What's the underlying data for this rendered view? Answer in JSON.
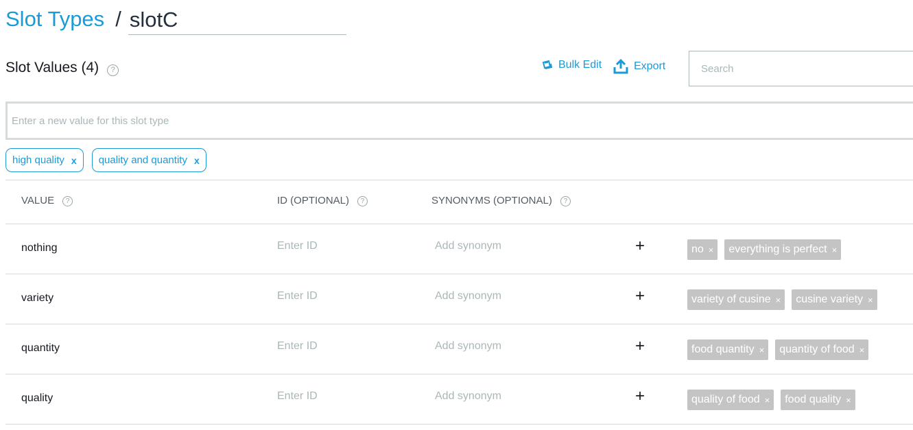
{
  "breadcrumb": {
    "link": "Slot Types",
    "separator": "/",
    "name_value": "slotC"
  },
  "section": {
    "title": "Slot Values (4)",
    "help": "?"
  },
  "toolbar": {
    "bulk_edit": "Bulk Edit",
    "export": "Export"
  },
  "search": {
    "placeholder": "Search"
  },
  "new_value": {
    "placeholder": "Enter a new value for this slot type"
  },
  "suggestions": [
    {
      "label": "high quality",
      "remove": "x"
    },
    {
      "label": "quality and quantity",
      "remove": "x"
    }
  ],
  "table": {
    "headers": {
      "value": "VALUE",
      "id": "ID (OPTIONAL)",
      "synonyms": "SYNONYMS (OPTIONAL)"
    },
    "id_placeholder": "Enter ID",
    "synonym_placeholder": "Add synonym",
    "add_symbol": "+",
    "remove_symbol": "×",
    "rows": [
      {
        "value": "nothing",
        "synonyms": [
          "no",
          "everything is perfect"
        ]
      },
      {
        "value": "variety",
        "synonyms": [
          "variety of cusine",
          "cusine variety"
        ]
      },
      {
        "value": "quantity",
        "synonyms": [
          "food quantity",
          "quantity of food"
        ]
      },
      {
        "value": "quality",
        "synonyms": [
          "quality of food",
          "food quality"
        ]
      }
    ]
  },
  "colors": {
    "accent": "#1a9bd7",
    "chip_gray": "#c4c4c4",
    "border": "#d5dbdb",
    "placeholder": "#aab7b8"
  }
}
